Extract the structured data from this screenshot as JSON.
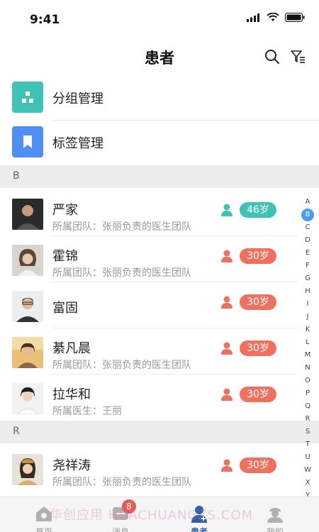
{
  "status_bar": {
    "time": "9:41"
  },
  "nav": {
    "title": "患者"
  },
  "management": [
    {
      "label": "分组管理",
      "icon": "group-icon",
      "color": "#3fc3b6"
    },
    {
      "label": "标签管理",
      "icon": "bookmark-icon",
      "color": "#4f8ef2"
    }
  ],
  "sections": [
    {
      "letter": "B",
      "patients": [
        {
          "name": "严家",
          "team": "所属团队：张丽负责的医生团队",
          "gender": "male",
          "age": "46岁"
        },
        {
          "name": "霍锦",
          "team": "所属团队：张丽负责的医生团队",
          "gender": "female",
          "age": "30岁"
        },
        {
          "name": "富固",
          "team": "",
          "gender": "female",
          "age": "30岁"
        },
        {
          "name": "綦凡晨",
          "team": "所属团队：张丽负责的医生团队",
          "gender": "female",
          "age": "30岁"
        },
        {
          "name": "拉华和",
          "team": "所属医生：王丽",
          "gender": "female",
          "age": "30岁"
        }
      ]
    },
    {
      "letter": "R",
      "patients": [
        {
          "name": "尧祥涛",
          "team": "所属团队：张丽负责的医生团队",
          "gender": "female",
          "age": "30岁"
        }
      ]
    }
  ],
  "alpha_index": {
    "letters": [
      "A",
      "B",
      "C",
      "D",
      "E",
      "F",
      "G",
      "H",
      "I",
      "J",
      "K",
      "L",
      "M",
      "N",
      "O",
      "P",
      "Q",
      "R",
      "S",
      "T",
      "U",
      "W",
      "X",
      "Y"
    ],
    "active": "B"
  },
  "tabbar": {
    "tabs": [
      {
        "label": "首页",
        "icon": "home-icon"
      },
      {
        "label": "消息",
        "icon": "message-icon",
        "badge": "8"
      },
      {
        "label": "患者",
        "icon": "patient-icon",
        "active": true
      },
      {
        "label": "我的",
        "icon": "profile-icon"
      }
    ]
  },
  "watermark": "华创应用 HUACHUANGZS.COM",
  "colors": {
    "male_age_badge": "#3fc3b6",
    "female_age_badge": "#f0705e",
    "male_icon": "#3fc3b6",
    "female_icon": "#f0705e",
    "active_tab": "#2f5fa8",
    "active_index": "#4a9cf0"
  }
}
